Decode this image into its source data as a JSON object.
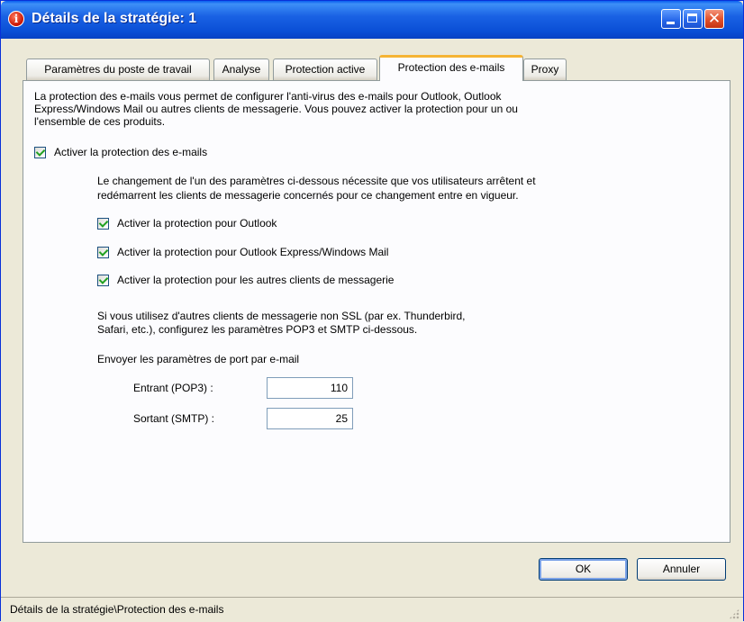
{
  "window": {
    "title": "Détails de la stratégie: 1",
    "app_icon_glyph": "i"
  },
  "title_buttons": {
    "close_glyph": "✕"
  },
  "tabs": [
    {
      "label": "Paramètres du poste de travail"
    },
    {
      "label": "Analyse"
    },
    {
      "label": "Protection active"
    },
    {
      "label": "Protection des e-mails"
    },
    {
      "label": "Proxy"
    }
  ],
  "active_tab": "Protection des e-mails",
  "intro": {
    "line1": "La protection des e-mails vous permet de configurer l'anti-virus des e-mails pour Outlook, Outlook",
    "line2": "Express/Windows Mail ou autres clients de messagerie. Vous pouvez activer la protection pour un ou",
    "line3": "l'ensemble de ces produits."
  },
  "enable_main": {
    "label": "Activer la protection des e-mails",
    "checked": true
  },
  "restart_note": {
    "line1": "Le changement de l'un des paramètres ci-dessous nécessite que vos utilisateurs arrêtent et",
    "line2": "redémarrent les clients de messagerie concernés pour ce changement entre en vigueur."
  },
  "options": [
    {
      "label": "Activer la protection pour Outlook",
      "checked": true
    },
    {
      "label": "Activer la protection pour Outlook Express/Windows Mail",
      "checked": true
    },
    {
      "label": "Activer la protection pour les autres clients de messagerie",
      "checked": true
    }
  ],
  "ssl_note": {
    "line1": "Si vous utilisez d'autres clients de messagerie non SSL (par ex. Thunderbird,",
    "line2": "Safari, etc.), configurez les paramètres POP3 et SMTP ci-dessous."
  },
  "ports": {
    "heading": "Envoyer les paramètres de port par e-mail",
    "incoming_label": "Entrant (POP3) :",
    "incoming_value": "110",
    "outgoing_label": "Sortant (SMTP) :",
    "outgoing_value": "25"
  },
  "buttons": {
    "ok": "OK",
    "cancel": "Annuler"
  },
  "status": {
    "text": "Détails de la stratégie\\Protection des e-mails"
  },
  "colors": {
    "title_blue": "#0a4fd6",
    "active_tab_accent": "#f5b434",
    "check_green": "#21a121"
  }
}
